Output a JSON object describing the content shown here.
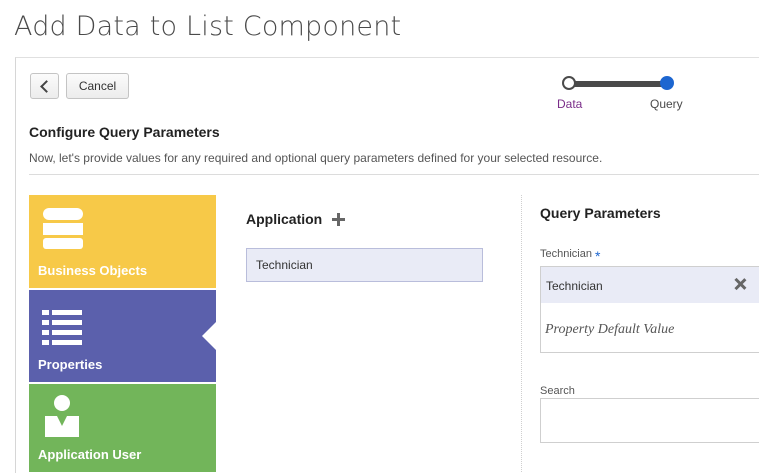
{
  "page": {
    "title": "Add Data to List Component"
  },
  "toolbar": {
    "cancel_label": "Cancel"
  },
  "train": {
    "steps": [
      {
        "label": "Data"
      },
      {
        "label": "Query"
      }
    ]
  },
  "configure": {
    "title": "Configure Query Parameters",
    "description": "Now, let's provide values for any required and optional query parameters defined for your selected resource."
  },
  "sources": [
    {
      "label": "Business Objects",
      "icon": "database-icon",
      "color": "#f7c948"
    },
    {
      "label": "Properties",
      "icon": "list-icon",
      "color": "#5b60ac"
    },
    {
      "label": "Application User",
      "icon": "user-icon",
      "color": "#72b55a"
    }
  ],
  "application": {
    "header": "Application",
    "items": [
      "Technician"
    ]
  },
  "query_parameters": {
    "title": "Query Parameters",
    "fields": [
      {
        "label": "Technician",
        "required_marker": "*",
        "chip": "Technician",
        "placeholder": "Property Default Value"
      },
      {
        "label": "Search"
      }
    ]
  },
  "colors": {
    "accent": "#1d66d0",
    "data_step": "#7a2d89"
  }
}
